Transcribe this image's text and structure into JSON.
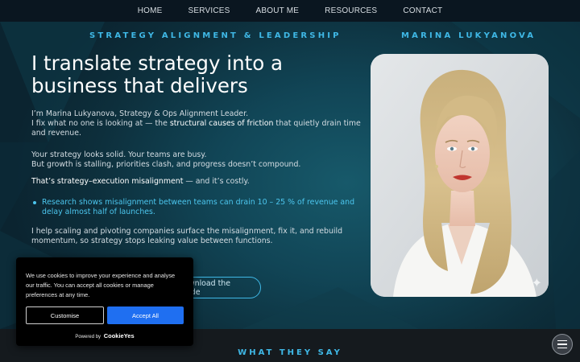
{
  "nav": {
    "items": [
      "HOME",
      "SERVICES",
      "ABOUT ME",
      "RESOURCES",
      "CONTACT"
    ]
  },
  "hero": {
    "eyebrow": "STRATEGY ALIGNMENT & LEADERSHIP",
    "name_eyebrow": "MARINA LUKYANOVA",
    "headline": "I translate strategy into a business that delivers",
    "intro_line1": "I’m Marina Lukyanova, Strategy & Ops Alignment Leader.",
    "intro_line2_a": "I fix what no one is looking at — the ",
    "intro_line2_b": "structural causes of friction",
    "intro_line2_c": " that quietly drain time and revenue.",
    "para2_line1": "Your strategy looks solid. Your teams are busy.",
    "para2_line2": "But growth is stalling, priorities clash, and progress doesn’t compound.",
    "para3_a": "That’s strategy–execution misalignment",
    "para3_b": " — and it’s costly.",
    "bullet": "Research shows misalignment between teams can drain 10 – 25 % of revenue and delay almost half of launches.",
    "para4": "I help scaling and pivoting companies surface the misalignment, fix it, and rebuild momentum, so strategy stops leaking value between functions.",
    "guide_button": "Download the Guide"
  },
  "section": {
    "title": "WHAT THEY SAY"
  },
  "cookie": {
    "text": "We use cookies to improve your experience and analyse our traffic. You can accept all cookies or manage preferences at any time.",
    "customise": "Customise",
    "accept": "Accept All",
    "powered_by": "Powered by",
    "brand": "CookieYes"
  },
  "colors": {
    "accent": "#3fb8e6",
    "accept_button": "#1f6ff1",
    "nav_bg": "#0a1620"
  },
  "icons": {
    "menu": "hamburger-menu-icon",
    "sparkle": "sparkle-icon"
  }
}
